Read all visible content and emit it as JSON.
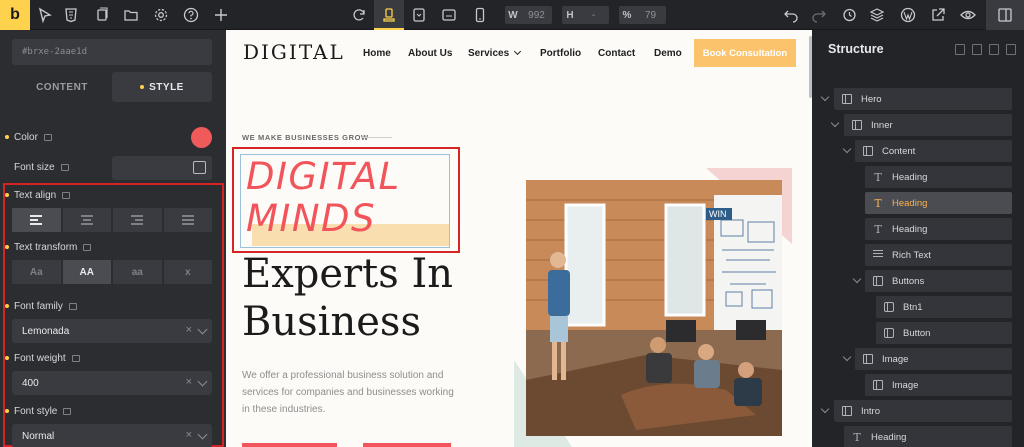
{
  "toolbar": {
    "logo": "b",
    "width_key": "W",
    "width_value": "992",
    "height_key": "H",
    "height_value": "-",
    "percent_key": "%",
    "percent_value": "79"
  },
  "left_panel": {
    "element_id": "#brxe-2aae1d",
    "tabs": [
      "CONTENT",
      "STYLE"
    ],
    "active_tab": "STYLE",
    "color_label": "Color",
    "color_value": "#f15a5a",
    "font_size_label": "Font size",
    "text_align_label": "Text align",
    "text_transform_label": "Text transform",
    "text_transform_options": [
      "Aa",
      "AA",
      "aa",
      "x"
    ],
    "text_transform_selected": "AA",
    "font_family_label": "Font family",
    "font_family_value": "Lemonada",
    "font_weight_label": "Font weight",
    "font_weight_value": "400",
    "font_style_label": "Font style",
    "font_style_value": "Normal",
    "clear_symbol": "×"
  },
  "canvas": {
    "logo": "DIGITAL",
    "nav": [
      "Home",
      "About Us",
      "Services",
      "Portfolio",
      "Contact",
      "Demo"
    ],
    "cta": "Book Consultation",
    "eyebrow": "WE MAKE BUSINESSES GROW",
    "hero_line1": "DIGITAL",
    "hero_line2": "MINDS",
    "headline_line1": "Experts In",
    "headline_line2": "Business",
    "description": "We offer a professional business solution and services for companies and businesses working in these industries.",
    "accent_color": "#f2545b",
    "cta_color": "#fbc46c"
  },
  "structure": {
    "title": "Structure",
    "nodes": [
      {
        "label": "Hero",
        "icon": "section-icon"
      },
      {
        "label": "Inner",
        "icon": "container-icon"
      },
      {
        "label": "Content",
        "icon": "block-icon"
      },
      {
        "label": "Heading",
        "icon": "heading-icon"
      },
      {
        "label": "Heading",
        "icon": "heading-icon",
        "selected": true
      },
      {
        "label": "Heading",
        "icon": "heading-icon"
      },
      {
        "label": "Rich Text",
        "icon": "rich-text-icon"
      },
      {
        "label": "Buttons",
        "icon": "block-icon"
      },
      {
        "label": "Btn1",
        "icon": "button-icon"
      },
      {
        "label": "Button",
        "icon": "button-icon"
      },
      {
        "label": "Image",
        "icon": "block-icon"
      },
      {
        "label": "Image",
        "icon": "image-icon"
      },
      {
        "label": "Intro",
        "icon": "section-icon"
      },
      {
        "label": "Heading",
        "icon": "heading-icon"
      }
    ],
    "selected_color": "#fbb24f"
  }
}
